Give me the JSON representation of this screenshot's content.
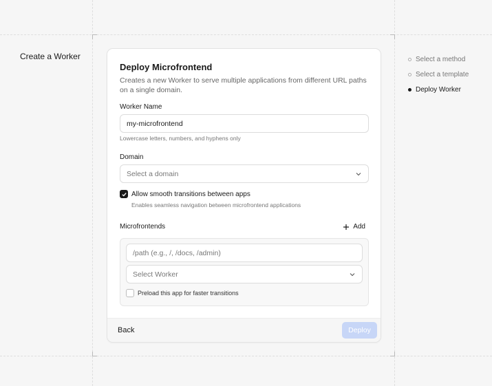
{
  "page": {
    "left_title": "Create a Worker"
  },
  "steps": [
    {
      "label": "Select a method",
      "active": false
    },
    {
      "label": "Select a template",
      "active": false
    },
    {
      "label": "Deploy Worker",
      "active": true
    }
  ],
  "card": {
    "title": "Deploy Microfrontend",
    "subtitle": "Creates a new Worker to serve multiple applications from different URL paths on a single domain."
  },
  "worker_name": {
    "label": "Worker Name",
    "value": "my-microfrontend",
    "help": "Lowercase letters, numbers, and hyphens only"
  },
  "domain": {
    "label": "Domain",
    "placeholder": "Select a domain"
  },
  "smooth_transitions": {
    "label": "Allow smooth transitions between apps",
    "help": "Enables seamless navigation between microfrontend applications",
    "checked": true
  },
  "microfrontends": {
    "label": "Microfrontends",
    "add_label": "Add",
    "items": [
      {
        "path_placeholder": "/path (e.g., /, /docs, /admin)",
        "worker_placeholder": "Select Worker",
        "preload_label": "Preload this app for faster transitions",
        "preload_checked": false
      }
    ]
  },
  "footer": {
    "back_label": "Back",
    "deploy_label": "Deploy"
  },
  "colors": {
    "deploy_disabled": "#c7d6f7",
    "checkbox_checked": "#1a1a1a"
  }
}
